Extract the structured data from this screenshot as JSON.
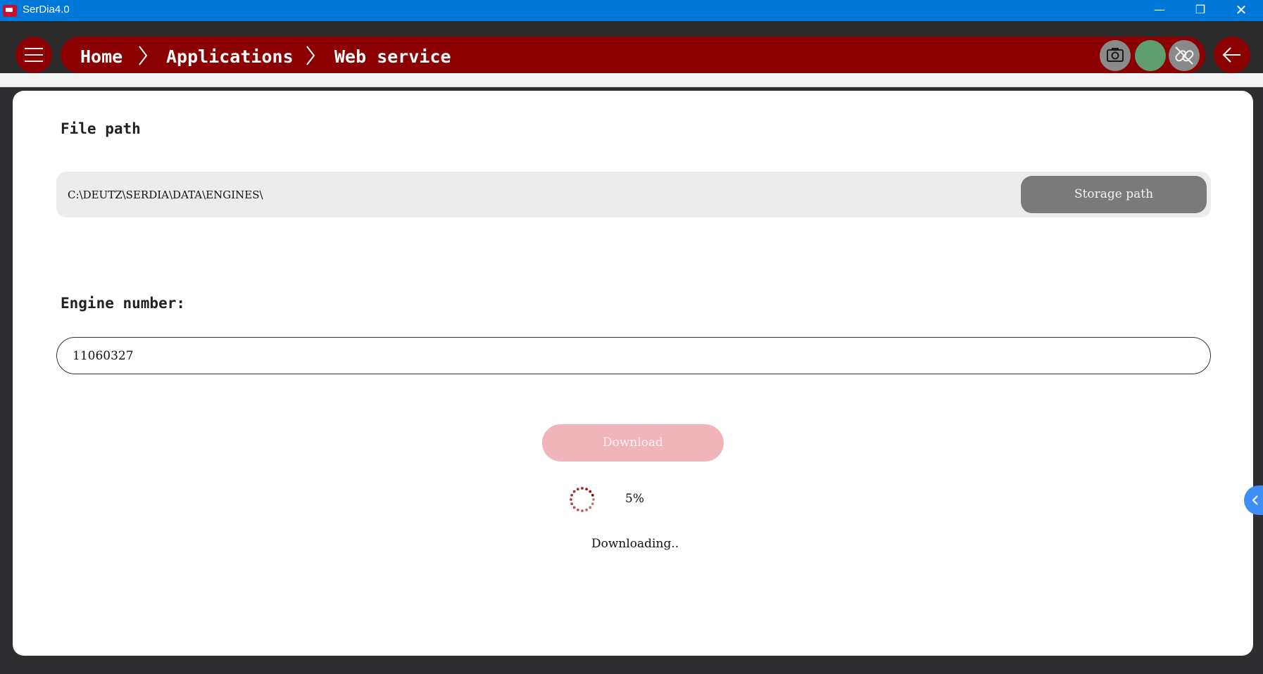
{
  "window": {
    "title": "SerDia4.0",
    "controls": {
      "minimize": "—",
      "maximize": "❐",
      "close": "✕"
    }
  },
  "breadcrumb": [
    "Home",
    "Applications",
    "Web service"
  ],
  "toolbar": {
    "icons": [
      "camera-icon",
      "connection-status-indicator",
      "link-broken-icon"
    ],
    "status_color": "#5f9e6f"
  },
  "file_path": {
    "label": "File path",
    "value": "C:\\DEUTZ\\SERDIA\\DATA\\ENGINES\\",
    "storage_button": "Storage path"
  },
  "engine": {
    "label": "Engine number:",
    "value": "11060327"
  },
  "download": {
    "button": "Download",
    "progress_percent": 5,
    "progress_text": "5%",
    "status": "Downloading.."
  },
  "colors": {
    "brand_red": "#8b0000",
    "title_blue": "#0078d7",
    "download_disabled": "#f2b4bb"
  }
}
